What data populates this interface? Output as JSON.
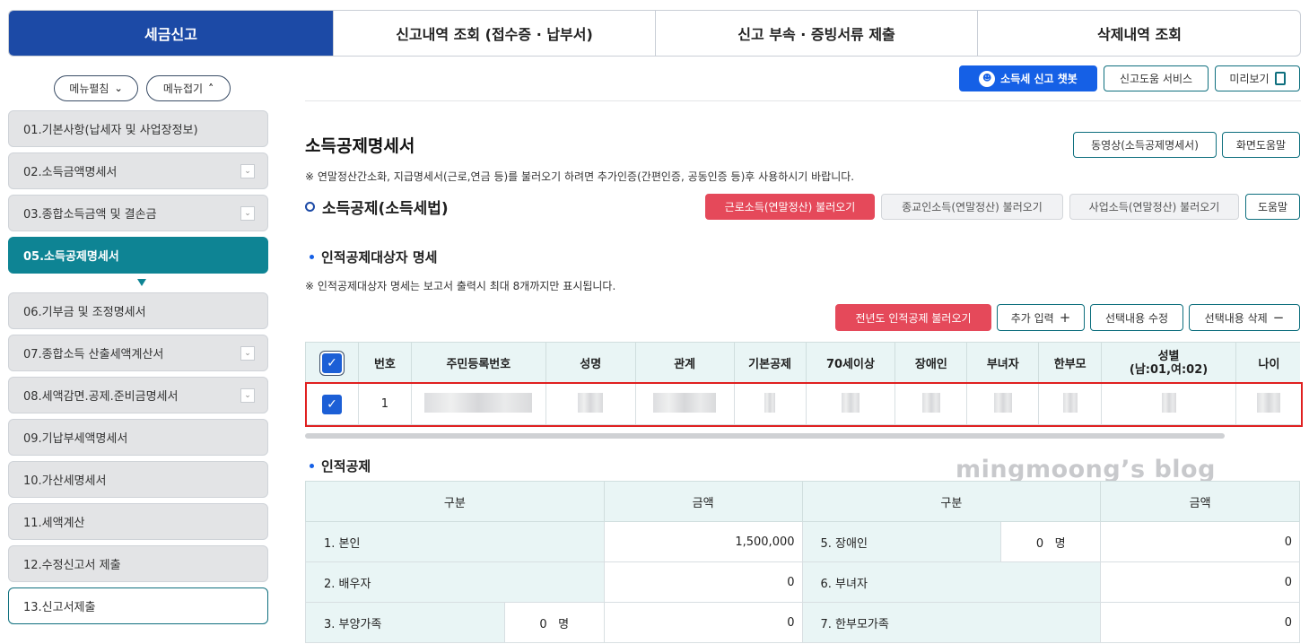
{
  "top_tabs": [
    "세금신고",
    "신고내역 조회 (접수증 · 납부서)",
    "신고 부속 · 증빙서류 제출",
    "삭제내역 조회"
  ],
  "menu_toggles": {
    "expand": "메뉴펼침",
    "collapse": "메뉴접기"
  },
  "sidebar": [
    {
      "label": "01.기본사항(납세자 및 사업장정보)",
      "dropdown": false
    },
    {
      "label": "02.소득금액명세서",
      "dropdown": true
    },
    {
      "label": "03.종합소득금액 및 결손금",
      "dropdown": true
    },
    {
      "label": "05.소득공제명세서",
      "dropdown": false
    },
    {
      "label": "06.기부금 및 조정명세서",
      "dropdown": false
    },
    {
      "label": "07.종합소득 산출세액계산서",
      "dropdown": true
    },
    {
      "label": "08.세액감면.공제.준비금명세서",
      "dropdown": true
    },
    {
      "label": "09.기납부세액명세서",
      "dropdown": false
    },
    {
      "label": "10.가산세명세서",
      "dropdown": false
    },
    {
      "label": "11.세액계산",
      "dropdown": false
    },
    {
      "label": "12.수정신고서 제출",
      "dropdown": false
    },
    {
      "label": "13.신고서제출",
      "dropdown": false
    }
  ],
  "top_buttons": {
    "chatbot": "소득세 신고 챗봇",
    "help_service": "신고도움 서비스",
    "preview": "미리보기"
  },
  "page": {
    "title": "소득공제명세서",
    "video_button": "동영상(소득공제명세서)",
    "screen_help_button": "화면도움말",
    "notice": "※ 연말정산간소화, 지급명세서(근로,연금 등)를 불러오기 하려면 추가인증(간편인증, 공동인증 등)후 사용하시기 바랍니다."
  },
  "section1": {
    "title": "소득공제(소득세법)",
    "buttons": [
      "근로소득(연말정산) 불러오기",
      "종교인소득(연말정산) 불러오기",
      "사업소득(연말정산) 불러오기",
      "도움말"
    ]
  },
  "dependents": {
    "title": "인적공제대상자 명세",
    "note": "※ 인적공제대상자 명세는 보고서 출력시 최대 8개까지만 표시됩니다.",
    "buttons": {
      "load_prev": "전년도 인적공제 불러오기",
      "add": "추가 입력",
      "edit": "선택내용 수정",
      "delete": "선택내용 삭제"
    },
    "columns": [
      "번호",
      "주민등록번호",
      "성명",
      "관계",
      "기본공제",
      "70세이상",
      "장애인",
      "부녀자",
      "한부모",
      "성별\n(남:01,여:02)",
      "나이"
    ],
    "rows": [
      {
        "no": "1"
      }
    ]
  },
  "deduction": {
    "title": "인적공제",
    "headers": [
      "구분",
      "금액",
      "구분",
      "금액"
    ],
    "rows": [
      {
        "left_label": "1. 본인",
        "left_amount": "1,500,000",
        "right_label": "5. 장애인",
        "right_count": "0",
        "right_unit": "명",
        "right_amount": "0"
      },
      {
        "left_label": "2. 배우자",
        "left_amount": "0",
        "right_label": "6. 부녀자",
        "right_amount": "0"
      },
      {
        "left_label": "3. 부양가족",
        "left_count": "0",
        "left_unit": "명",
        "left_amount": "0",
        "right_label": "7. 한부모가족",
        "right_amount": "0"
      }
    ]
  },
  "watermark": "mingmoong’s blog",
  "colors": {
    "primary_blue": "#1c4aa6",
    "teal_active": "#0e8494",
    "red_button": "#e5495a",
    "chatbot_blue": "#1560e6",
    "highlight_box": "#e02020"
  }
}
